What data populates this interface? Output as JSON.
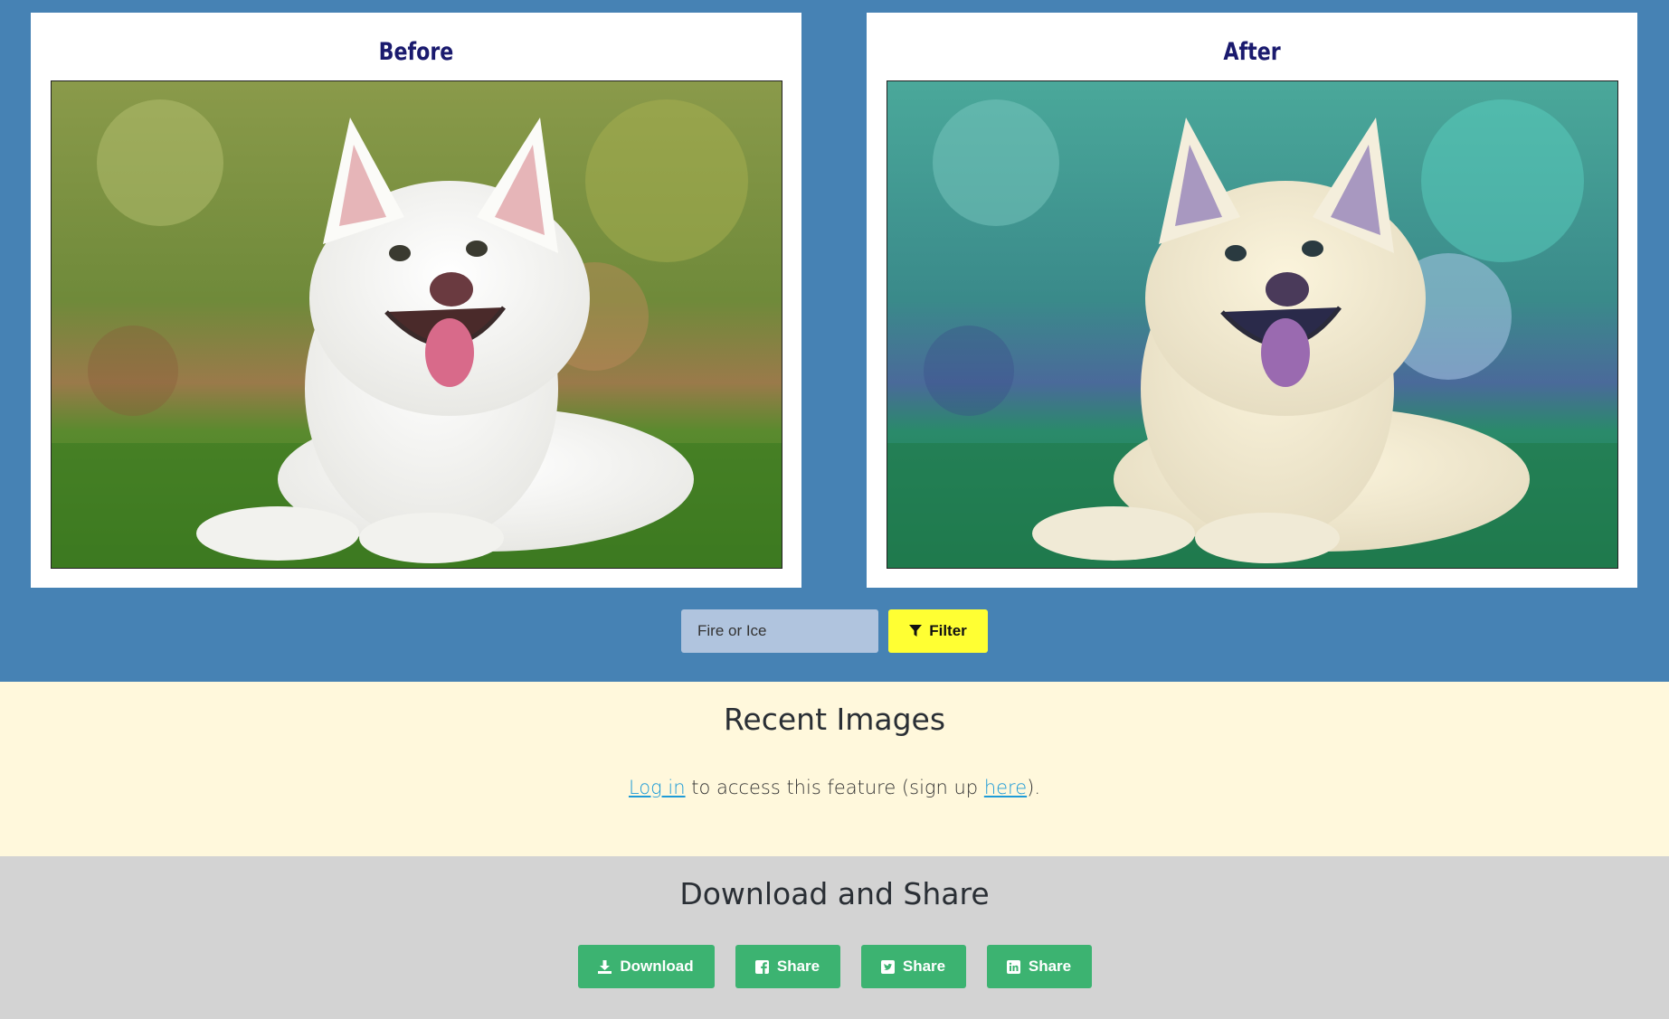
{
  "comparison": {
    "before": {
      "title": "Before"
    },
    "after": {
      "title": "After"
    }
  },
  "filter": {
    "input_placeholder": "Fire or Ice",
    "button_label": "Filter",
    "button_icon": "filter-icon"
  },
  "recent": {
    "title": "Recent Images",
    "login_link": "Log in",
    "text_middle": " to access this feature (sign up ",
    "signup_link": "here",
    "text_end": ")."
  },
  "share": {
    "title": "Download and Share",
    "buttons": [
      {
        "label": "Download",
        "icon": "download-icon"
      },
      {
        "label": "Share",
        "icon": "facebook-icon"
      },
      {
        "label": "Share",
        "icon": "twitter-icon"
      },
      {
        "label": "Share",
        "icon": "linkedin-icon"
      }
    ]
  },
  "colors": {
    "top_background": "#4682b4",
    "recent_background": "#fff8dc",
    "share_background": "#d3d3d3",
    "filter_button": "#ffff33",
    "share_button": "#3cb371",
    "link": "#1e9bd7",
    "panel_title": "#1a1a6e"
  }
}
